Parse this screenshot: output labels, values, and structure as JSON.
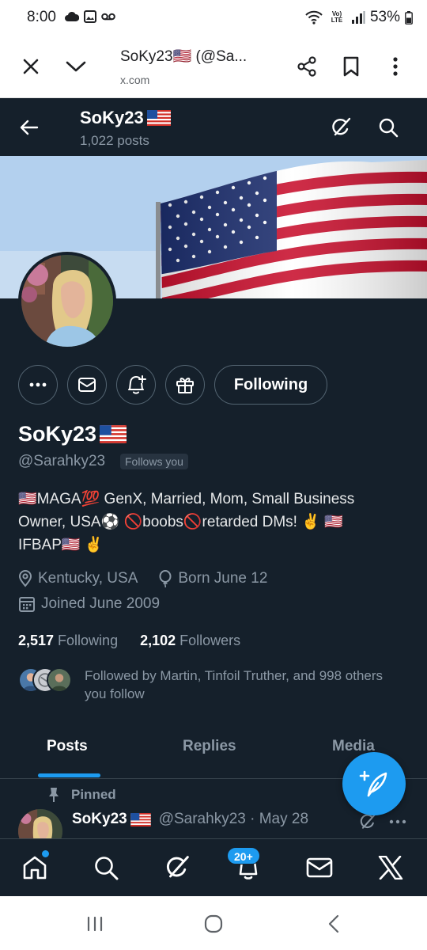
{
  "status_bar": {
    "time": "8:00",
    "network_label": "Vo) LTE",
    "battery": "53%"
  },
  "browser": {
    "title": "SoKy23🇺🇸 (@Sa...",
    "url": "x.com"
  },
  "header": {
    "name": "SoKy23",
    "posts_count": "1,022 posts"
  },
  "profile": {
    "display_name": "SoKy23",
    "handle": "@Sarahky23",
    "follows_you": "Follows you",
    "following_button": "Following",
    "bio_line1": "🇺🇸MAGA💯 GenX, Married, Mom, Small Business",
    "bio_line2": "Owner, USA⚽ 🚫boobs🚫retarded DMs! ✌️ 🇺🇸",
    "bio_line3": "IFBAP🇺🇸 ✌️",
    "location": "Kentucky, USA",
    "birthday": "Born June 12",
    "joined": "Joined June 2009",
    "following_count": "2,517",
    "following_label": "Following",
    "followers_count": "2,102",
    "followers_label": "Followers",
    "followed_by": "Followed by Martin, Tinfoil Truther, and 998 others you follow"
  },
  "tabs": [
    {
      "label": "Posts",
      "active": true
    },
    {
      "label": "Replies",
      "active": false
    },
    {
      "label": "Media",
      "active": false
    }
  ],
  "pinned_post": {
    "pinned_label": "Pinned",
    "author": "SoKy23",
    "handle_date": "@Sarahky23 · May 28"
  },
  "bottom_nav": {
    "items": [
      "home-icon",
      "search-icon",
      "grok-icon",
      "notifications-icon",
      "messages-icon",
      "x-logo-icon"
    ],
    "notifications_badge": "20+"
  },
  "colors": {
    "background": "#15202b",
    "accent": "#1d9bf0",
    "secondary_text": "#8b98a5",
    "border": "#536471"
  }
}
